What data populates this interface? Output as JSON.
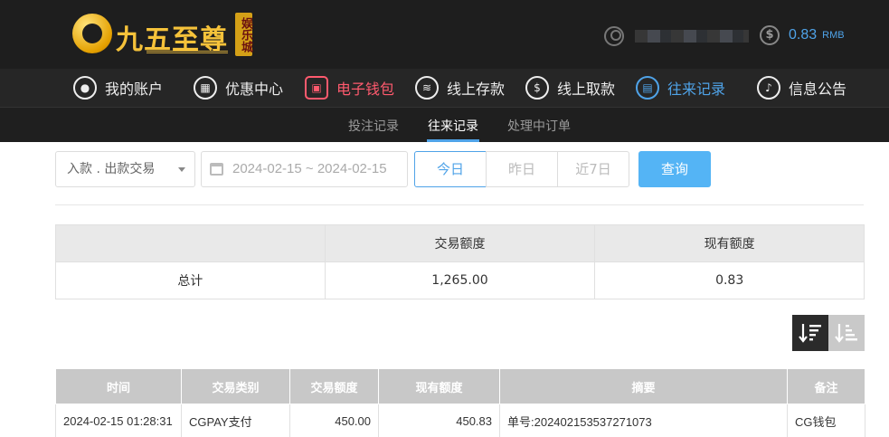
{
  "brand": {
    "name": "九五至尊",
    "badge": "娱乐城"
  },
  "header": {
    "balance_value": "0.83",
    "balance_unit": "RMB"
  },
  "nav": {
    "items": [
      {
        "label": "我的账户",
        "icon": "user-icon"
      },
      {
        "label": "优惠中心",
        "icon": "gift-icon"
      },
      {
        "label": "电子钱包",
        "icon": "wallet-icon"
      },
      {
        "label": "线上存款",
        "icon": "deposit-icon"
      },
      {
        "label": "线上取款",
        "icon": "withdraw-icon"
      },
      {
        "label": "往来记录",
        "icon": "records-icon"
      },
      {
        "label": "信息公告",
        "icon": "bell-icon"
      }
    ]
  },
  "subnav": {
    "items": [
      "投注记录",
      "往来记录",
      "处理中订单"
    ],
    "active": "往来记录"
  },
  "filters": {
    "type_select": "入款 . 出款交易",
    "date_range": "2024-02-15 ~ 2024-02-15",
    "today": "今日",
    "yesterday": "昨日",
    "last7": "近7日",
    "query": "查询"
  },
  "summary": {
    "headers": [
      "",
      "交易额度",
      "现有额度"
    ],
    "row": {
      "label": "总计",
      "amount": "1,265.00",
      "balance": "0.83"
    }
  },
  "records": {
    "headers": [
      "时间",
      "交易类别",
      "交易额度",
      "现有额度",
      "摘要",
      "备注"
    ],
    "rows": [
      [
        "2024-02-15 01:28:31",
        "CGPAY支付",
        "450.00",
        "450.83",
        "单号:202402153537271073",
        "CG钱包"
      ]
    ]
  },
  "colors": {
    "accent_blue": "#4fa3e8",
    "accent_red": "#ff5a6e",
    "brand_gold": "#f5c23a",
    "header_bg": "#1e1e1e"
  }
}
